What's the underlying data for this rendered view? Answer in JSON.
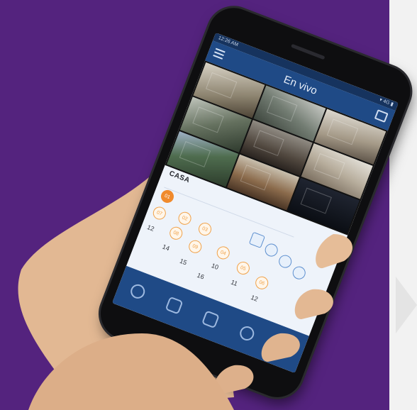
{
  "phone_screen": {
    "status_time": "12:26 AM",
    "status_right": "▾ 4G ▮",
    "title": "En vivo",
    "device_name": "CASA",
    "active_channel": "01",
    "channels_row1": [
      "01"
    ],
    "channels_row2": [
      "02",
      "03"
    ],
    "channels_row3": [
      "07",
      "08",
      "09",
      "04",
      "05",
      "06"
    ],
    "numbers": [
      "12",
      "14",
      "15",
      "16",
      "10",
      "11",
      "12"
    ]
  },
  "colors": {
    "background": "#54237e",
    "app_blue": "#1f4a86",
    "accent_orange": "#f08a2c"
  },
  "icons": {
    "topbar_left": "menu-icon",
    "topbar_right": "layout-grid-icon",
    "tabs": [
      "playback-icon",
      "talk-icon",
      "grid-view-icon",
      "ptz-icon",
      "devices-icon"
    ]
  }
}
